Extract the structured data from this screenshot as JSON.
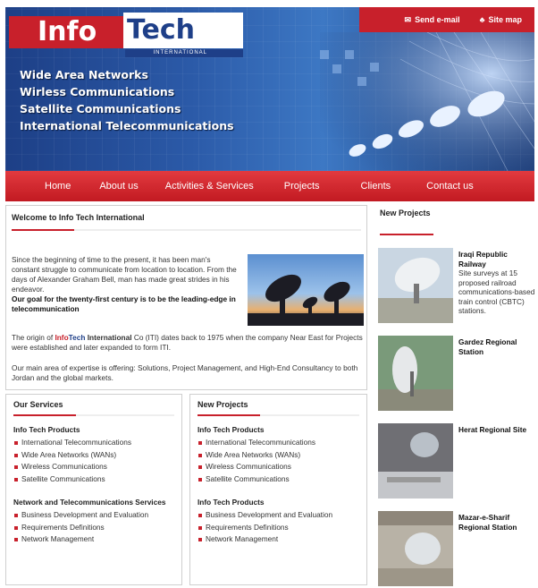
{
  "header": {
    "logo_info": "Info",
    "logo_tech": "Tech",
    "logo_international": "INTERNATIONAL",
    "toplinks": [
      {
        "label": "Send e-mail",
        "icon": "mail-icon"
      },
      {
        "label": "Site map",
        "icon": "sitemap-icon"
      }
    ],
    "taglines": [
      "Wide Area Networks",
      "Wirless Communications",
      "Satellite Communications",
      "International Telecommunications"
    ]
  },
  "nav": [
    "Home",
    "About us",
    "Activities & Services",
    "Projects",
    "Clients",
    "Contact us"
  ],
  "welcome": {
    "title": "Welcome to Info Tech International",
    "intro": "Since the beginning of time to the present, it has been man's constant struggle to communicate from location to location. From the days of Alexander Graham Bell, man has made great strides in his endeavor.",
    "intro_bold": "Our goal for the twenty-first century is to be the leading-edge in telecommunication",
    "origin_pre": "The origin of ",
    "origin_info": "Info",
    "origin_tech": "Tech",
    "origin_intl": "International",
    "origin_post": " Co (ITI) dates back to 1975 when the company Near East for Projects were established and later expanded to form ITI.",
    "expertise": "Our main area of expertise is offering: Solutions, Project Management, and High-End Consultancy to both Jordan and the global markets."
  },
  "services": {
    "title": "Our Services",
    "group1_title": "Info Tech Products",
    "group1": [
      "International Telecommunications",
      "Wide Area Networks (WANs)",
      "Wireless Communications",
      "Satellite Communications"
    ],
    "group2_title": "Network and Telecommunications Services",
    "group2": [
      "Business Development and Evaluation",
      "Requirements Definitions",
      "Network Management"
    ]
  },
  "new_projects_mid": {
    "title": "New Projects",
    "group1_title": "Info Tech Products",
    "group1": [
      "International Telecommunications",
      "Wide Area Networks (WANs)",
      "Wireless Communications",
      "Satellite Communications"
    ],
    "group2_title": "Info Tech Products",
    "group2": [
      "Business Development and Evaluation",
      "Requirements Definitions",
      "Network Management"
    ]
  },
  "side": {
    "title": "New Projects",
    "projects": [
      {
        "title": "Iraqi Republic Railway",
        "desc": "Site surveys at 15 proposed railroad communications-based train control (CBTC) stations."
      },
      {
        "title": "Gardez Regional Station",
        "desc": ""
      },
      {
        "title": "Herat Regional Site",
        "desc": ""
      },
      {
        "title": "Mazar-e-Sharif Regional Station",
        "desc": ""
      }
    ]
  },
  "colors": {
    "brand_red": "#c8202b",
    "brand_blue": "#1e3f88"
  }
}
